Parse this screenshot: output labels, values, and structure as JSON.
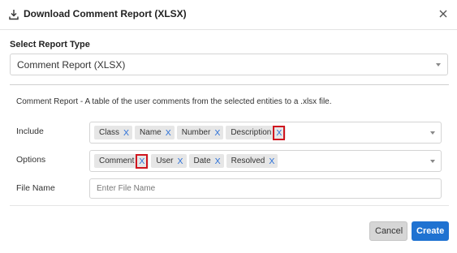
{
  "dialog": {
    "title": "Download Comment Report (XLSX)",
    "icons": {
      "download": "download-icon",
      "close": "close-icon"
    }
  },
  "report_type": {
    "label": "Select Report Type",
    "value": "Comment Report (XLSX)"
  },
  "description": "Comment Report  -  A table of the user comments from the selected entities to a .xlsx file.",
  "include": {
    "label": "Include",
    "tags": [
      "Class",
      "Name",
      "Number",
      "Description"
    ]
  },
  "options": {
    "label": "Options",
    "tags": [
      "Comment",
      "User",
      "Date",
      "Resolved"
    ]
  },
  "file_name": {
    "label": "File Name",
    "placeholder": "Enter File Name",
    "value": ""
  },
  "tag_remove_glyph": "X",
  "buttons": {
    "cancel": "Cancel",
    "create": "Create"
  },
  "colors": {
    "accent": "#1f72d1",
    "tag_remove": "#2a6fd8",
    "highlight": "#d0161f",
    "tag_bg": "#e6e6e6"
  }
}
